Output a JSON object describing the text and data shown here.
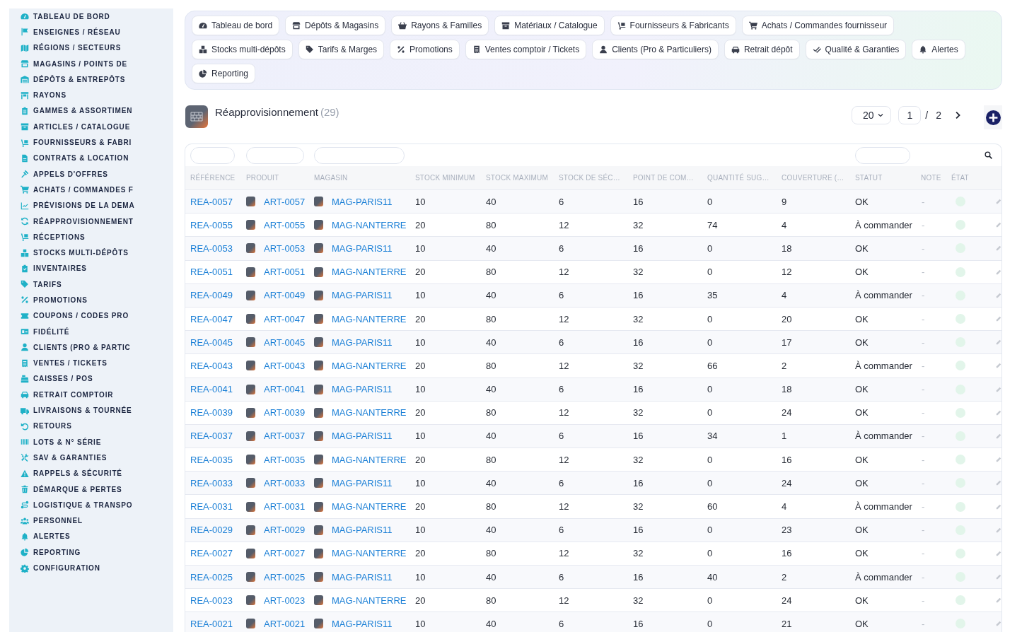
{
  "sidebar": {
    "items": [
      "TABLEAU DE BORD",
      "ENSEIGNES / RÉSEAU",
      "RÉGIONS / SECTEURS",
      "MAGASINS / POINTS DE",
      "DÉPÔTS & ENTREPÔTS",
      "RAYONS",
      "GAMMES & ASSORTIMEN",
      "ARTICLES / CATALOGUE",
      "FOURNISSEURS & FABRI",
      "CONTRATS & LOCATION",
      "APPELS D'OFFRES",
      "ACHATS / COMMANDES F",
      "PRÉVISIONS DE LA DEMA",
      "RÉAPPROVISIONNEMENT",
      "RÉCEPTIONS",
      "STOCKS MULTI-DÉPÔTS",
      "INVENTAIRES",
      "TARIFS",
      "PROMOTIONS",
      "COUPONS / CODES PRO",
      "FIDÉLITÉ",
      "CLIENTS (PRO & PARTIC",
      "VENTES / TICKETS",
      "CAISSES / POS",
      "RETRAIT COMPTOIR",
      "LIVRAISONS & TOURNÉE",
      "RETOURS",
      "LOTS & N° SÉRIE",
      "SAV & GARANTIES",
      "RAPPELS & SÉCURITÉ",
      "DÉMARQUE & PERTES",
      "LOGISTIQUE & TRANSPO",
      "PERSONNEL",
      "ALERTES",
      "REPORTING",
      "CONFIGURATION"
    ]
  },
  "nav_tabs": [
    "Tableau de bord",
    "Dépôts & Magasins",
    "Rayons & Familles",
    "Matériaux / Catalogue",
    "Fournisseurs & Fabricants",
    "Achats / Commandes fournisseur",
    "Stocks multi-dépôts",
    "Tarifs & Marges",
    "Promotions",
    "Ventes comptoir / Tickets",
    "Clients (Pro & Particuliers)",
    "Retrait dépôt",
    "Qualité & Garanties",
    "Alertes",
    "Reporting"
  ],
  "page_header": {
    "title": "Réapprovisionnement",
    "count": "(29)"
  },
  "pagination": {
    "page_size": "20",
    "page": "1",
    "separator": "/",
    "total_pages": "2"
  },
  "table": {
    "columns": [
      "RÉFÉRENCE",
      "PRODUIT",
      "MAGASIN",
      "STOCK MINIMUM",
      "STOCK MAXIMUM",
      "STOCK DE SÉC…",
      "POINT DE COM…",
      "QUANTITÉ SUG…",
      "COUVERTURE (…",
      "STATUT",
      "NOTE",
      "ÉTAT"
    ],
    "rows": [
      {
        "reference": "REA-0057",
        "product": "ART-0057",
        "store": "MAG-PARIS11",
        "stock_min": "10",
        "stock_max": "40",
        "safety_stock": "6",
        "reorder_point": "16",
        "suggested_qty": "0",
        "coverage": "9",
        "status": "OK",
        "note": "-"
      },
      {
        "reference": "REA-0055",
        "product": "ART-0055",
        "store": "MAG-NANTERRE",
        "stock_min": "20",
        "stock_max": "80",
        "safety_stock": "12",
        "reorder_point": "32",
        "suggested_qty": "74",
        "coverage": "4",
        "status": "À commander",
        "note": "-"
      },
      {
        "reference": "REA-0053",
        "product": "ART-0053",
        "store": "MAG-PARIS11",
        "stock_min": "10",
        "stock_max": "40",
        "safety_stock": "6",
        "reorder_point": "16",
        "suggested_qty": "0",
        "coverage": "18",
        "status": "OK",
        "note": "-"
      },
      {
        "reference": "REA-0051",
        "product": "ART-0051",
        "store": "MAG-NANTERRE",
        "stock_min": "20",
        "stock_max": "80",
        "safety_stock": "12",
        "reorder_point": "32",
        "suggested_qty": "0",
        "coverage": "12",
        "status": "OK",
        "note": "-"
      },
      {
        "reference": "REA-0049",
        "product": "ART-0049",
        "store": "MAG-PARIS11",
        "stock_min": "10",
        "stock_max": "40",
        "safety_stock": "6",
        "reorder_point": "16",
        "suggested_qty": "35",
        "coverage": "4",
        "status": "À commander",
        "note": "-"
      },
      {
        "reference": "REA-0047",
        "product": "ART-0047",
        "store": "MAG-NANTERRE",
        "stock_min": "20",
        "stock_max": "80",
        "safety_stock": "12",
        "reorder_point": "32",
        "suggested_qty": "0",
        "coverage": "20",
        "status": "OK",
        "note": "-"
      },
      {
        "reference": "REA-0045",
        "product": "ART-0045",
        "store": "MAG-PARIS11",
        "stock_min": "10",
        "stock_max": "40",
        "safety_stock": "6",
        "reorder_point": "16",
        "suggested_qty": "0",
        "coverage": "17",
        "status": "OK",
        "note": "-"
      },
      {
        "reference": "REA-0043",
        "product": "ART-0043",
        "store": "MAG-NANTERRE",
        "stock_min": "20",
        "stock_max": "80",
        "safety_stock": "12",
        "reorder_point": "32",
        "suggested_qty": "66",
        "coverage": "2",
        "status": "À commander",
        "note": "-"
      },
      {
        "reference": "REA-0041",
        "product": "ART-0041",
        "store": "MAG-PARIS11",
        "stock_min": "10",
        "stock_max": "40",
        "safety_stock": "6",
        "reorder_point": "16",
        "suggested_qty": "0",
        "coverage": "18",
        "status": "OK",
        "note": "-"
      },
      {
        "reference": "REA-0039",
        "product": "ART-0039",
        "store": "MAG-NANTERRE",
        "stock_min": "20",
        "stock_max": "80",
        "safety_stock": "12",
        "reorder_point": "32",
        "suggested_qty": "0",
        "coverage": "24",
        "status": "OK",
        "note": "-"
      },
      {
        "reference": "REA-0037",
        "product": "ART-0037",
        "store": "MAG-PARIS11",
        "stock_min": "10",
        "stock_max": "40",
        "safety_stock": "6",
        "reorder_point": "16",
        "suggested_qty": "34",
        "coverage": "1",
        "status": "À commander",
        "note": "-"
      },
      {
        "reference": "REA-0035",
        "product": "ART-0035",
        "store": "MAG-NANTERRE",
        "stock_min": "20",
        "stock_max": "80",
        "safety_stock": "12",
        "reorder_point": "32",
        "suggested_qty": "0",
        "coverage": "16",
        "status": "OK",
        "note": "-"
      },
      {
        "reference": "REA-0033",
        "product": "ART-0033",
        "store": "MAG-PARIS11",
        "stock_min": "10",
        "stock_max": "40",
        "safety_stock": "6",
        "reorder_point": "16",
        "suggested_qty": "0",
        "coverage": "24",
        "status": "OK",
        "note": "-"
      },
      {
        "reference": "REA-0031",
        "product": "ART-0031",
        "store": "MAG-NANTERRE",
        "stock_min": "20",
        "stock_max": "80",
        "safety_stock": "12",
        "reorder_point": "32",
        "suggested_qty": "60",
        "coverage": "4",
        "status": "À commander",
        "note": "-"
      },
      {
        "reference": "REA-0029",
        "product": "ART-0029",
        "store": "MAG-PARIS11",
        "stock_min": "10",
        "stock_max": "40",
        "safety_stock": "6",
        "reorder_point": "16",
        "suggested_qty": "0",
        "coverage": "23",
        "status": "OK",
        "note": "-"
      },
      {
        "reference": "REA-0027",
        "product": "ART-0027",
        "store": "MAG-NANTERRE",
        "stock_min": "20",
        "stock_max": "80",
        "safety_stock": "12",
        "reorder_point": "32",
        "suggested_qty": "0",
        "coverage": "16",
        "status": "OK",
        "note": "-"
      },
      {
        "reference": "REA-0025",
        "product": "ART-0025",
        "store": "MAG-PARIS11",
        "stock_min": "10",
        "stock_max": "40",
        "safety_stock": "6",
        "reorder_point": "16",
        "suggested_qty": "40",
        "coverage": "2",
        "status": "À commander",
        "note": "-"
      },
      {
        "reference": "REA-0023",
        "product": "ART-0023",
        "store": "MAG-NANTERRE",
        "stock_min": "20",
        "stock_max": "80",
        "safety_stock": "12",
        "reorder_point": "32",
        "suggested_qty": "0",
        "coverage": "24",
        "status": "OK",
        "note": "-"
      },
      {
        "reference": "REA-0021",
        "product": "ART-0021",
        "store": "MAG-PARIS11",
        "stock_min": "10",
        "stock_max": "40",
        "safety_stock": "6",
        "reorder_point": "16",
        "suggested_qty": "0",
        "coverage": "21",
        "status": "OK",
        "note": "-"
      }
    ]
  }
}
